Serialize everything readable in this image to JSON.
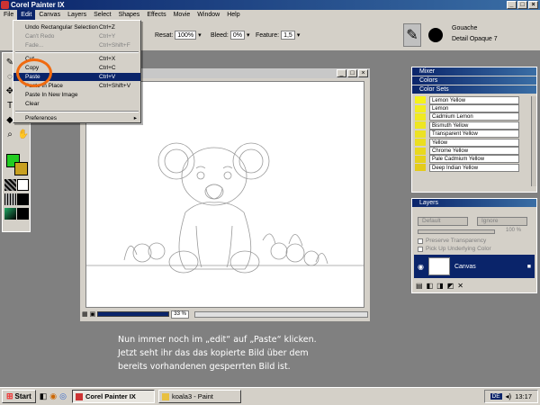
{
  "window": {
    "title": "Corel Painter IX"
  },
  "menubar": {
    "items": [
      "File",
      "Edit",
      "Canvas",
      "Layers",
      "Select",
      "Shapes",
      "Effects",
      "Movie",
      "Window",
      "Help"
    ]
  },
  "edit_menu": {
    "items": [
      {
        "label": "Undo Rectangular Selection",
        "shortcut": "Ctrl+Z",
        "disabled": false
      },
      {
        "label": "Can't Redo",
        "shortcut": "Ctrl+Y",
        "disabled": true
      },
      {
        "label": "Fade...",
        "shortcut": "Ctrl+Shift+F",
        "disabled": true
      },
      {
        "label": "Cut",
        "shortcut": "Ctrl+X",
        "disabled": false
      },
      {
        "label": "Copy",
        "shortcut": "Ctrl+C",
        "disabled": false
      },
      {
        "label": "Paste",
        "shortcut": "Ctrl+V",
        "disabled": false,
        "highlighted": true
      },
      {
        "label": "Paste In Place",
        "shortcut": "Ctrl+Shift+V",
        "disabled": false
      },
      {
        "label": "Paste In New Image",
        "shortcut": "",
        "disabled": false
      },
      {
        "label": "Clear",
        "shortcut": "",
        "disabled": false
      },
      {
        "label": "Preferences",
        "shortcut": "",
        "disabled": false,
        "submenu": true
      }
    ]
  },
  "property_bar": {
    "resat_label": "Resat:",
    "resat_value": "100%",
    "bleed_label": "Bleed:",
    "bleed_value": "0%",
    "feature_label": "Feature:",
    "feature_value": "1,5",
    "brush_category": "Gouache",
    "brush_variant": "Detail Opaque 7"
  },
  "document": {
    "zoom": "33 %"
  },
  "panels": {
    "mixer": "Mixer",
    "colors": "Colors",
    "color_sets": "Color Sets",
    "layers": "Layers",
    "composite_method": "Default",
    "composite_depth": "Ignore",
    "opacity": "100 %",
    "preserve_transparency": "Preserve Transparency",
    "pick_up_underlying": "Pick Up Underlying Color",
    "layer_name": "Canvas"
  },
  "color_set": [
    {
      "name": "Lemon Yellow",
      "color": "#f5f21a"
    },
    {
      "name": "Lemon",
      "color": "#f2ee1e"
    },
    {
      "name": "Cadmium Lemon",
      "color": "#f0ea20"
    },
    {
      "name": "Bismuth Yellow",
      "color": "#eee622"
    },
    {
      "name": "Transparent Yellow",
      "color": "#ece224"
    },
    {
      "name": "Yellow",
      "color": "#ebde20"
    },
    {
      "name": "Chrome Yellow",
      "color": "#e9d81e"
    },
    {
      "name": "Pale Cadmium Yellow",
      "color": "#e6d21c"
    },
    {
      "name": "Deep Indian Yellow",
      "color": "#e3cb1a"
    }
  ],
  "caption": {
    "line1": "Nun immer noch im „edit“ auf „Paste“ klicken.",
    "line2": "Jetzt seht ihr das das kopierte Bild über dem",
    "line3": "bereits vorhandenen gesperrten Bild ist."
  },
  "taskbar": {
    "start": "Start",
    "task1": "Corel Painter IX",
    "task2": "koala3 - Paint",
    "lang": "DE",
    "time": "13:17"
  },
  "colors": {
    "accent": "#0a246a",
    "highlight_circle": "#f06a10",
    "primary_color": "#22cc22",
    "secondary_color": "#c8a020"
  }
}
